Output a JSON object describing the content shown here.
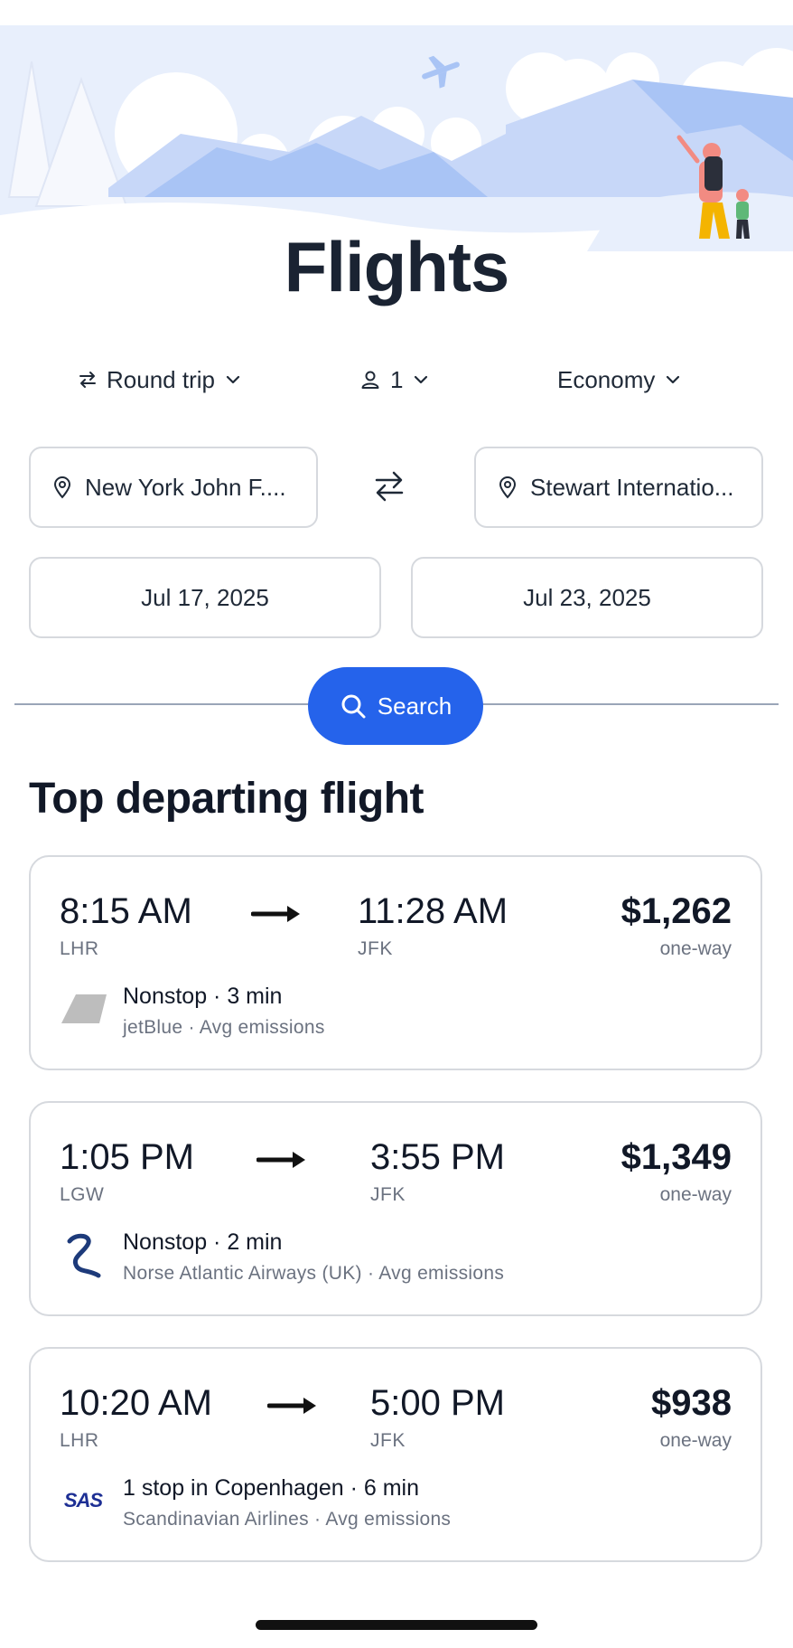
{
  "page": {
    "title": "Flights"
  },
  "options": {
    "trip_type": "Round trip",
    "passengers": "1",
    "cabin_class": "Economy"
  },
  "search_form": {
    "origin": "New York John F....",
    "destination": "Stewart Internatio...",
    "depart_date": "Jul 17, 2025",
    "return_date": "Jul 23, 2025",
    "search_label": "Search"
  },
  "results": {
    "heading": "Top departing flight",
    "flights": [
      {
        "depart_time": "8:15 AM",
        "depart_airport": "LHR",
        "arrive_time": "11:28 AM",
        "arrive_airport": "JFK",
        "price": "$1,262",
        "price_note": "one-way",
        "stops": "Nonstop · 3 min",
        "details": "jetBlue · Avg emissions",
        "airline_icon": "jetblue-tail-icon"
      },
      {
        "depart_time": "1:05 PM",
        "depart_airport": "LGW",
        "arrive_time": "3:55 PM",
        "arrive_airport": "JFK",
        "price": "$1,349",
        "price_note": "one-way",
        "stops": "Nonstop · 2 min",
        "details": "Norse Atlantic Airways (UK) · Avg emissions",
        "airline_icon": "norse-logo-icon"
      },
      {
        "depart_time": "10:20 AM",
        "depart_airport": "LHR",
        "arrive_time": "5:00 PM",
        "arrive_airport": "JFK",
        "price": "$938",
        "price_note": "one-way",
        "stops": "1 stop in Copenhagen · 6 min",
        "details": "Scandinavian Airlines · Avg emissions",
        "airline_logo_text": "SAS"
      }
    ]
  },
  "colors": {
    "accent": "#2563eb",
    "hero_light": "#e8effc",
    "hero_mid": "#a9c4f5"
  }
}
